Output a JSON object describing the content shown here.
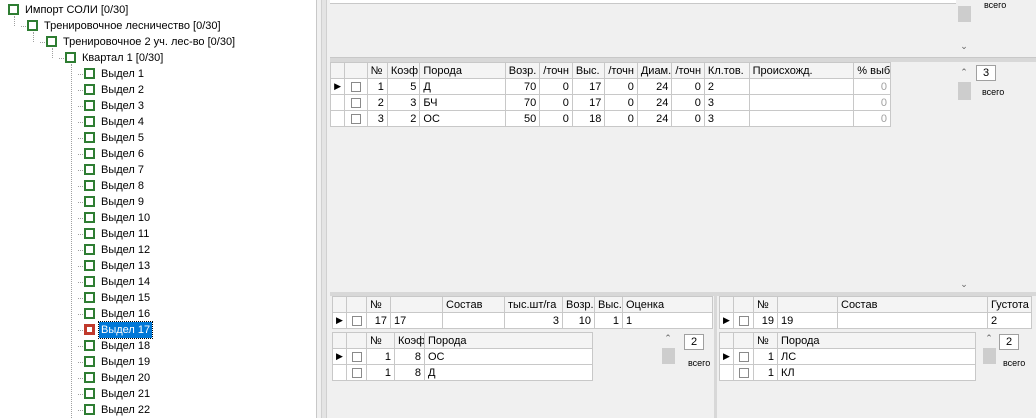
{
  "tree": {
    "nodes": [
      {
        "label": "Импорт СОЛИ  [0/30]",
        "level": 0
      },
      {
        "label": "Тренировочное лесничество [0/30]",
        "level": 1
      },
      {
        "label": "Тренировочное 2 уч. лес-во [0/30]",
        "level": 2
      },
      {
        "label": "Квартал 1 [0/30]",
        "level": 3
      },
      {
        "label": "Выдел 1",
        "level": 4
      },
      {
        "label": "Выдел 2",
        "level": 4
      },
      {
        "label": "Выдел 3",
        "level": 4
      },
      {
        "label": "Выдел 4",
        "level": 4
      },
      {
        "label": "Выдел 5",
        "level": 4
      },
      {
        "label": "Выдел 6",
        "level": 4
      },
      {
        "label": "Выдел 7",
        "level": 4
      },
      {
        "label": "Выдел 8",
        "level": 4
      },
      {
        "label": "Выдел 9",
        "level": 4
      },
      {
        "label": "Выдел 10",
        "level": 4
      },
      {
        "label": "Выдел 11",
        "level": 4
      },
      {
        "label": "Выдел 12",
        "level": 4
      },
      {
        "label": "Выдел 13",
        "level": 4
      },
      {
        "label": "Выдел 14",
        "level": 4
      },
      {
        "label": "Выдел 15",
        "level": 4
      },
      {
        "label": "Выдел 16",
        "level": 4
      },
      {
        "label": "Выдел 17",
        "level": 4,
        "selected": true
      },
      {
        "label": "Выдел 18",
        "level": 4
      },
      {
        "label": "Выдел 19",
        "level": 4
      },
      {
        "label": "Выдел 20",
        "level": 4
      },
      {
        "label": "Выдел 21",
        "level": 4
      },
      {
        "label": "Выдел 22",
        "level": 4
      }
    ]
  },
  "top_panel": {
    "count_label": "всего"
  },
  "species_grid": {
    "headers": [
      "№",
      "Коэф.",
      "Порода",
      "Возр.",
      "/точн",
      "Выс.",
      "/точн",
      "Диам.",
      "/точн",
      "Кл.тов.",
      "Происхожд.",
      "% выб"
    ],
    "rows": [
      [
        "1",
        "5",
        "Д",
        "70",
        "0",
        "17",
        "0",
        "24",
        "0",
        "2",
        "",
        "0"
      ],
      [
        "2",
        "3",
        "БЧ",
        "70",
        "0",
        "17",
        "0",
        "24",
        "0",
        "3",
        "",
        "0"
      ],
      [
        "3",
        "2",
        "ОС",
        "50",
        "0",
        "18",
        "0",
        "24",
        "0",
        "3",
        "",
        "0"
      ]
    ],
    "count": "3",
    "count_label": "всего"
  },
  "undergrowth_grid": {
    "headers": [
      "№",
      "",
      "Состав",
      "тыс.шт/га",
      "Возр.",
      "Выс.",
      "Оценка"
    ],
    "row": [
      "17",
      "17",
      "",
      "3",
      "10",
      "1",
      "1"
    ]
  },
  "undergrowth_species": {
    "headers": [
      "№",
      "Коэф.",
      "Порода"
    ],
    "rows": [
      [
        "1",
        "8",
        "ОС"
      ],
      [
        "1",
        "8",
        "Д"
      ]
    ],
    "count": "2",
    "count_label": "всего"
  },
  "underbrush_grid": {
    "headers": [
      "№",
      "",
      "Состав",
      "Густота"
    ],
    "row": [
      "19",
      "19",
      "",
      "2"
    ]
  },
  "underbrush_species": {
    "headers": [
      "№",
      "Порода"
    ],
    "rows": [
      [
        "1",
        "ЛС"
      ],
      [
        "1",
        "КЛ"
      ]
    ],
    "count": "2",
    "count_label": "всего"
  },
  "colors": {
    "checkbox": "#2e7d32",
    "selection": "#0078d7",
    "selected_checkbox": "#c0392b"
  }
}
